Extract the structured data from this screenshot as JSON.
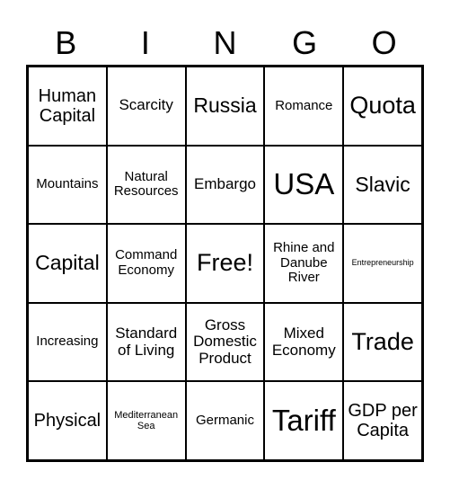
{
  "header": {
    "letters": [
      "B",
      "I",
      "N",
      "G",
      "O"
    ]
  },
  "card": {
    "rows": [
      [
        "Human Capital",
        "Scarcity",
        "Russia",
        "Romance",
        "Quota"
      ],
      [
        "Mountains",
        "Natural Resources",
        "Embargo",
        "USA",
        "Slavic"
      ],
      [
        "Capital",
        "Command Economy",
        "Free!",
        "Rhine and Danube River",
        "Entrepreneurship"
      ],
      [
        "Increasing",
        "Standard of Living",
        "Gross Domestic Product",
        "Mixed Economy",
        "Trade"
      ],
      [
        "Physical",
        "Mediterranean Sea",
        "Germanic",
        "Tariff",
        "GDP per Capita"
      ]
    ]
  }
}
